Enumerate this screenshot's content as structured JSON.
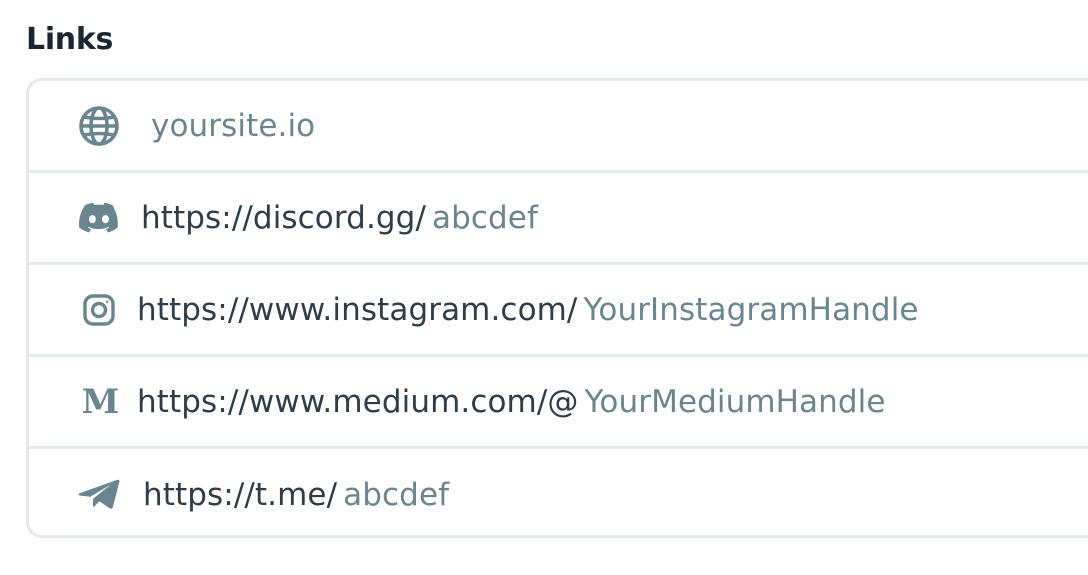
{
  "section": {
    "title": "Links"
  },
  "links": [
    {
      "icon": "globe-icon",
      "prefix": "",
      "value": "yoursite.io"
    },
    {
      "icon": "discord-icon",
      "prefix": "https://discord.gg/",
      "value": "abcdef"
    },
    {
      "icon": "instagram-icon",
      "prefix": "https://www.instagram.com/",
      "value": "YourInstagramHandle"
    },
    {
      "icon": "medium-icon",
      "icon_glyph": "M",
      "prefix": "https://www.medium.com/@",
      "value": "YourMediumHandle"
    },
    {
      "icon": "telegram-icon",
      "prefix": "https://t.me/",
      "value": "abcdef"
    }
  ],
  "colors": {
    "title": "#1b2632",
    "prefix_text": "#2e3d47",
    "value_text": "#6b858f",
    "icon": "#6b858f",
    "border": "#e3eaee"
  }
}
